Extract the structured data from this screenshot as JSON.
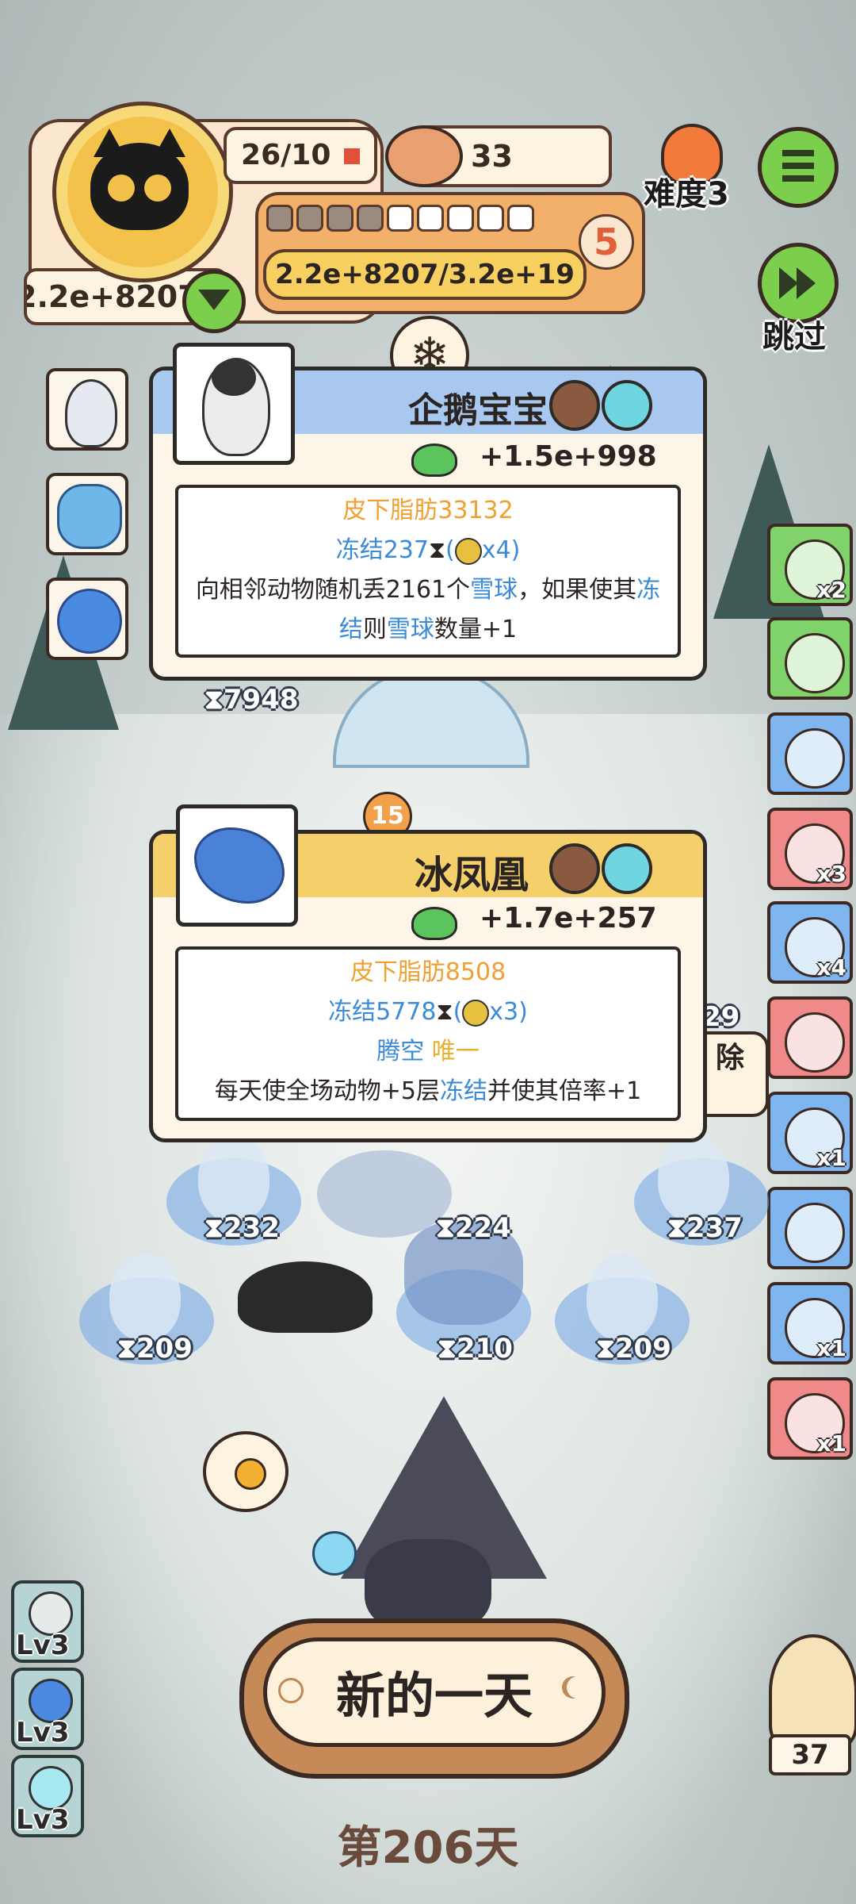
{
  "hud": {
    "progress_count": "26/10",
    "can_count": "33",
    "difficulty": "难度3",
    "level_number": "5",
    "score_text": "2.2e+8207/3.2e+19",
    "money": "2.2e+8207",
    "skip_label": "跳过",
    "segments_filled": 4,
    "segments_total": 9
  },
  "card1": {
    "title": "企鹅宝宝",
    "gain": "+1.5e+998",
    "line1": "皮下脂肪33132",
    "line2_a": "冻结237",
    "line2_b": "(",
    "line2_c": "x4)",
    "line3_a": "向相邻动物随机丢2161个",
    "line3_b": "雪球",
    "line3_c": "，如果使其",
    "line3_d": "冻",
    "line4_a": "结",
    "line4_b": "则",
    "line4_c": "雪球",
    "line4_d": "数量+1"
  },
  "card2": {
    "title": "冰凤凰",
    "gain": "+1.7e+257",
    "line1": "皮下脂肪8508",
    "line2_a": "冻结5778",
    "line2_b": "(",
    "line2_c": "x3)",
    "line3_a": "腾空",
    "line3_b": "唯一",
    "line4_a": "每天使全场动物+5层",
    "line4_b": "冻结",
    "line4_c": "并使其倍率+1"
  },
  "board": {
    "timer_top": "7948",
    "badge_15": "15",
    "partial_29": "29",
    "partial_remove": "除",
    "timers": [
      "232",
      "224",
      "237",
      "209",
      "210",
      "209"
    ]
  },
  "right_items": [
    {
      "name": "teacup-icon",
      "count": "x2",
      "bg": "#7fd36a"
    },
    {
      "name": "card-icon",
      "count": "",
      "bg": "#7fd36a"
    },
    {
      "name": "ticket-icon",
      "count": "",
      "bg": "#7fb6f0"
    },
    {
      "name": "goggles-icon",
      "count": "x3",
      "bg": "#f08a8a"
    },
    {
      "name": "cookie-icon",
      "count": "x4",
      "bg": "#7fb6f0"
    },
    {
      "name": "cloud-icon",
      "count": "",
      "bg": "#f08a8a"
    },
    {
      "name": "flying-fish-icon",
      "count": "x1",
      "bg": "#7fb6f0"
    },
    {
      "name": "mittens-icon",
      "count": "",
      "bg": "#7fb6f0"
    },
    {
      "name": "hockey-stick-icon",
      "count": "x1",
      "bg": "#7fb6f0"
    },
    {
      "name": "gift-bag-icon",
      "count": "x1",
      "bg": "#f08a8a"
    }
  ],
  "levels": [
    "Lv3",
    "Lv3",
    "Lv3"
  ],
  "bottom": {
    "new_day": "新的一天",
    "day_label": "第206天",
    "owl_count": "37"
  }
}
